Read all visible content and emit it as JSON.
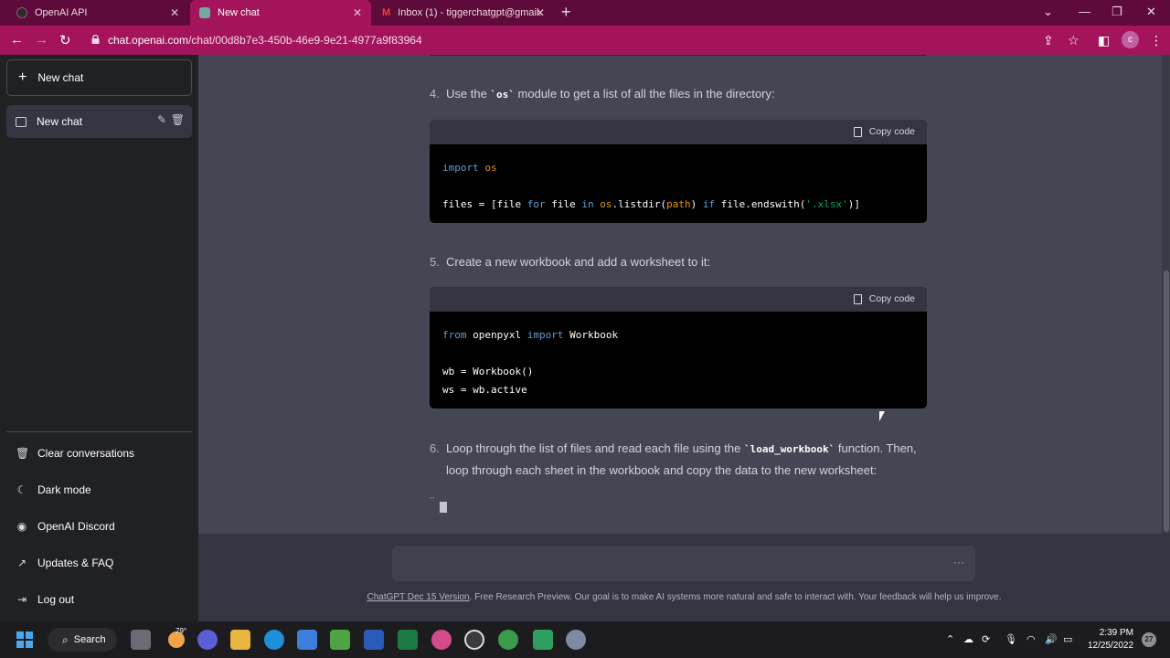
{
  "browser": {
    "tabs": [
      {
        "label": "OpenAI API",
        "active": false
      },
      {
        "label": "New chat",
        "active": true
      },
      {
        "label": "Inbox (1) - tiggerchatgpt@gmail.",
        "active": false
      }
    ],
    "url_host": "chat.openai.com",
    "url_path": "/chat/00d8b7e3-450b-46e9-9e21-4977a9f83964",
    "profile_initial": "c",
    "colors": {
      "tabbar": "#5e0b3b",
      "accent": "#a3145c"
    }
  },
  "sidebar": {
    "new_chat_label": "New chat",
    "chats": [
      {
        "label": "New chat"
      }
    ],
    "items": [
      {
        "label": "Clear conversations",
        "icon": "trash-icon"
      },
      {
        "label": "Dark mode",
        "icon": "moon-icon"
      },
      {
        "label": "OpenAI Discord",
        "icon": "discord-icon"
      },
      {
        "label": "Updates & FAQ",
        "icon": "external-link-icon"
      },
      {
        "label": "Log out",
        "icon": "logout-icon"
      }
    ]
  },
  "conversation": {
    "step4": {
      "num": "4.",
      "before": "Use the ",
      "code": "`os`",
      "after": " module to get a list of all the files in the directory:"
    },
    "step5": {
      "num": "5.",
      "text": "Create a new workbook and add a worksheet to it:"
    },
    "step6": {
      "num": "6.",
      "before": "Loop through the list of files and read each file using the ",
      "code": "`load_workbook`",
      "after": " function. Then,",
      "line2": "loop through each sheet in the workbook and copy the data to the new worksheet:"
    },
    "copy_label": "Copy code",
    "streaming_tick": "``"
  },
  "input": {
    "dots": "···"
  },
  "footer": {
    "link": "ChatGPT Dec 15 Version",
    "text": ". Free Research Preview. Our goal is to make AI systems more natural and safe to interact with. Your feedback will help us improve."
  },
  "taskbar": {
    "search_label": "Search",
    "weather_temp": "79°",
    "time": "2:39 PM",
    "date": "12/25/2022",
    "notifications": "27"
  }
}
